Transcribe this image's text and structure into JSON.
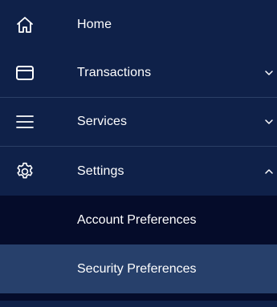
{
  "nav": {
    "items": [
      {
        "label": "Home",
        "icon": "home-icon",
        "expanded": null
      },
      {
        "label": "Transactions",
        "icon": "card-icon",
        "expanded": false
      },
      {
        "label": "Services",
        "icon": "menu-icon",
        "expanded": false
      },
      {
        "label": "Settings",
        "icon": "gear-icon",
        "expanded": true
      }
    ],
    "settings_subitems": [
      {
        "label": "Account Preferences"
      },
      {
        "label": "Security Preferences"
      }
    ]
  },
  "colors": {
    "nav_background": "#0f2149",
    "submenu_background": "#050c2a",
    "submenu_highlight": "#27406b",
    "text": "#ffffff",
    "divider": "#2b3f66"
  }
}
